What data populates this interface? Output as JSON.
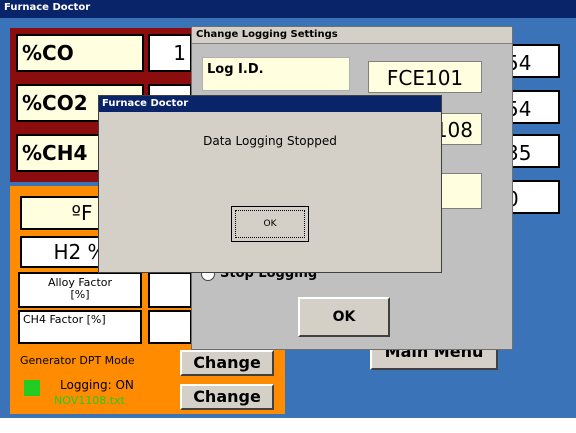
{
  "window": {
    "title": "Furnace Doctor"
  },
  "readings": [
    {
      "label": "%CO",
      "value": "1"
    },
    {
      "label": "%CO2",
      "value": ""
    },
    {
      "label": "%CH4",
      "value": ""
    }
  ],
  "right_values": [
    "54",
    "54",
    "35",
    "0"
  ],
  "orange_panel": {
    "temp_unit": "ºF",
    "h2_label": "H2 %",
    "alloy_factor": "Alloy Factor\n[%]",
    "ch4_factor": "CH4 Factor [%]",
    "dpt_mode": "Generator DPT Mode",
    "dpt_change": "Change",
    "logging_status": "Logging: ON",
    "log_file": "NOV1108.txt",
    "logging_change": "Change",
    "logging_indicator_color": "#22cc22"
  },
  "main_menu": "Main Menu",
  "logging_settings": {
    "title": "Change Logging Settings",
    "log_id_label": "Log I.D.",
    "log_id_value": "FCE101",
    "file_value": "108",
    "stop_logging_label": "Stop Logging",
    "ok_label": "OK"
  },
  "message_box": {
    "title": "Furnace Doctor",
    "message": "Data Logging Stopped",
    "ok_label": "OK"
  }
}
